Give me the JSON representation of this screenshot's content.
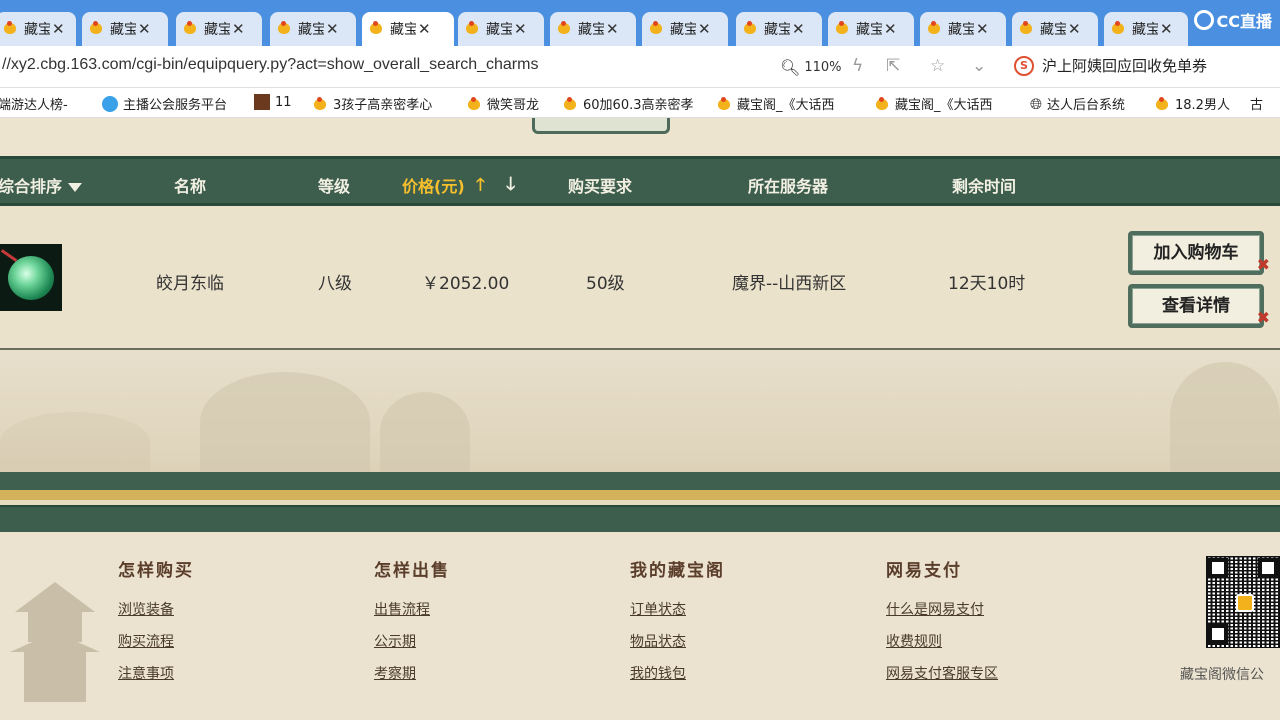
{
  "browser": {
    "tabs": [
      {
        "label": "藏宝",
        "active": false
      },
      {
        "label": "藏宝",
        "active": false
      },
      {
        "label": "藏宝",
        "active": false
      },
      {
        "label": "藏宝",
        "active": false
      },
      {
        "label": "藏宝",
        "active": true
      },
      {
        "label": "藏宝",
        "active": false
      },
      {
        "label": "藏宝",
        "active": false
      },
      {
        "label": "藏宝",
        "active": false
      },
      {
        "label": "藏宝",
        "active": false
      },
      {
        "label": "藏宝",
        "active": false
      },
      {
        "label": "藏宝",
        "active": false
      },
      {
        "label": "藏宝",
        "active": false
      },
      {
        "label": "藏宝",
        "active": false
      }
    ],
    "brand": "CC直播",
    "url": "//xy2.cbg.163.com/cgi-bin/equipquery.py?act=show_overall_search_charms",
    "zoom": "110%",
    "search_text": "沪上阿姨回应回收免单券",
    "bookmarks": [
      {
        "label": "端游达人榜-",
        "icon": "generic"
      },
      {
        "label": "主播公会服务平台",
        "icon": "blue-face-icon"
      },
      {
        "label": "11",
        "icon": "game-icon"
      },
      {
        "label": "3孩子高亲密孝心",
        "icon": "chick-icon"
      },
      {
        "label": "微笑哥龙",
        "icon": "chick-icon"
      },
      {
        "label": "60加60.3高亲密孝",
        "icon": "chick-icon"
      },
      {
        "label": "藏宝阁_《大话西",
        "icon": "chick-icon"
      },
      {
        "label": "藏宝阁_《大话西",
        "icon": "chick-icon"
      },
      {
        "label": "达人后台系统",
        "icon": "globe-icon"
      },
      {
        "label": "18.2男人",
        "icon": "chick-icon"
      },
      {
        "label": "古",
        "icon": "generic"
      }
    ]
  },
  "table": {
    "headers": {
      "sort": "综合排序",
      "name": "名称",
      "level": "等级",
      "price": "价格(元)",
      "requirement": "购买要求",
      "server": "所在服务器",
      "time_left": "剩余时间"
    },
    "rows": [
      {
        "name": "皎月东临",
        "level": "八级",
        "price": "￥2052.00",
        "requirement": "50级",
        "server": "魔界--山西新区",
        "time_left": "12天10时"
      }
    ],
    "actions": {
      "add_cart": "加入购物车",
      "view_detail": "查看详情"
    }
  },
  "footer": {
    "columns": [
      {
        "title": "怎样购买",
        "links": [
          "浏览装备",
          "购买流程",
          "注意事项"
        ]
      },
      {
        "title": "怎样出售",
        "links": [
          "出售流程",
          "公示期",
          "考察期"
        ]
      },
      {
        "title": "我的藏宝阁",
        "links": [
          "订单状态",
          "物品状态",
          "我的钱包"
        ]
      },
      {
        "title": "网易支付",
        "links": [
          "什么是网易支付",
          "收费规则",
          "网易支付客服专区"
        ]
      }
    ],
    "qr_caption": "藏宝阁微信公"
  },
  "colors": {
    "tabbar": "#4a8fe0",
    "table_header": "#3d5d4d",
    "price_accent": "#f6c02d",
    "page_bg": "#ece4cf"
  }
}
